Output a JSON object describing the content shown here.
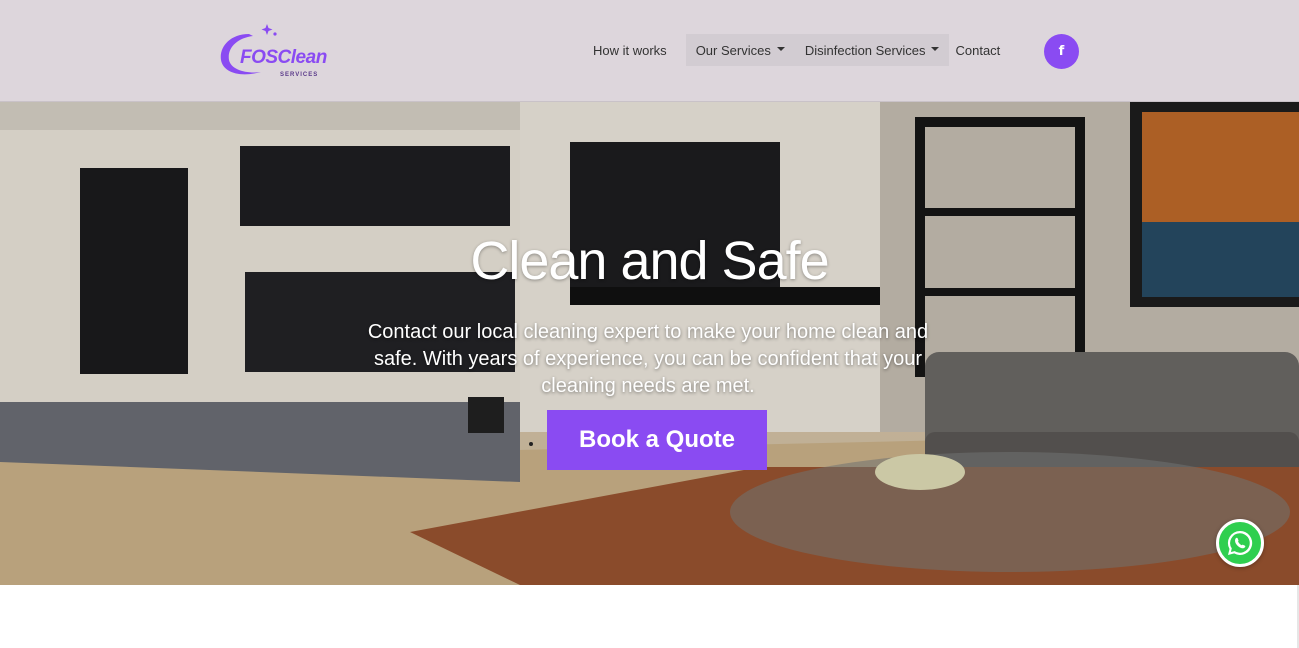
{
  "brand": {
    "name": "FOSClean",
    "tagline": "SERVICES",
    "accent_color": "#8a4bf2"
  },
  "nav": {
    "items": [
      {
        "label": "How it works"
      },
      {
        "label": "Our Services",
        "has_dropdown": true
      },
      {
        "label": "Disinfection Services",
        "has_dropdown": true
      },
      {
        "label": "Contact"
      }
    ],
    "social": {
      "label": "f",
      "icon": "facebook-icon"
    }
  },
  "hero": {
    "title": "Clean and Safe",
    "text": "Contact our local cleaning expert to make your home clean and safe. With years of experience, you can be confident that your cleaning needs are met.",
    "cta_label": "Book a Quote"
  },
  "floating": {
    "icon": "whatsapp-icon",
    "color": "#2fcf4f"
  }
}
